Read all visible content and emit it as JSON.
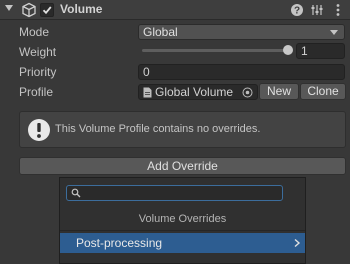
{
  "component": {
    "title": "Volume",
    "enabled": true
  },
  "fields": {
    "mode_label": "Mode",
    "mode_value": "Global",
    "weight_label": "Weight",
    "weight_value": "1",
    "weight_slider_fraction": 1.0,
    "priority_label": "Priority",
    "priority_value": "0",
    "profile_label": "Profile",
    "profile_value": "Global Volume",
    "new_label": "New",
    "clone_label": "Clone"
  },
  "helpbox": {
    "message": "This Volume Profile contains no overrides."
  },
  "add_override_label": "Add Override",
  "popup": {
    "search_value": "",
    "title": "Volume Overrides",
    "items": [
      {
        "label": "Post-processing"
      }
    ]
  },
  "icons": {
    "component": "cube-icon",
    "help": "help-icon",
    "settings": "settings-sliders-icon",
    "menu": "kebab-menu-icon",
    "info": "info-icon",
    "search": "search-icon",
    "asset": "asset-icon",
    "picker": "target-picker-icon"
  },
  "colors": {
    "selection": "#2d5d91",
    "search_focus": "#3c6d9c"
  }
}
